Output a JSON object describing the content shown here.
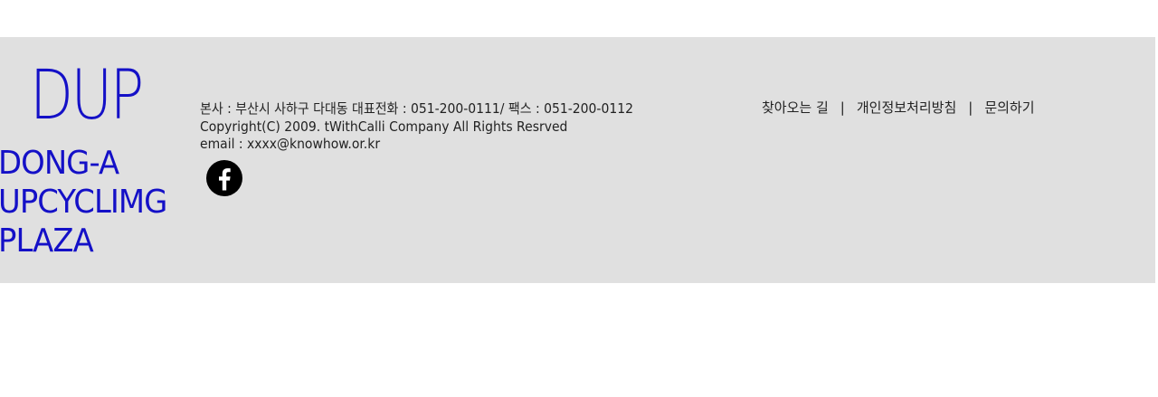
{
  "logo": {
    "mark": "DUP",
    "lines": [
      "DONG-A",
      "UPCYCLIMG",
      "PLAZA"
    ]
  },
  "info": {
    "address": "본사 : 부산시 사하구 다대동  대표전화 : 051-200-0111/ 팩스 : 051-200-0112",
    "copyright": "Copyright(C) 2009. tWithCalli Company All Rights Resrved",
    "email": "email : xxxx@knowhow.or.kr"
  },
  "social": {
    "icon": "facebook-icon"
  },
  "links": {
    "directions": "찾아오는 길",
    "privacy": "개인정보처리방침",
    "contact": "문의하기",
    "separator": "|"
  },
  "colors": {
    "footer_bg": "#e0e0e0",
    "brand_blue": "#1410c7",
    "text": "#222222"
  }
}
